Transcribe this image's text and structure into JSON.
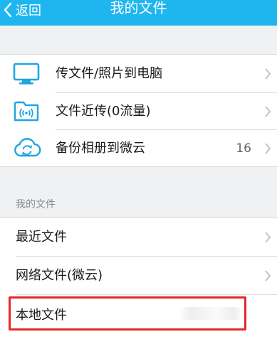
{
  "navbar": {
    "back_label": "返回",
    "title": "我的文件",
    "background_color": "#1fb6f0"
  },
  "top_group": {
    "items": [
      {
        "label": "传文件/照片到电脑",
        "icon": "monitor-icon"
      },
      {
        "label": "文件近传(0流量)",
        "icon": "wireless-folder-icon"
      },
      {
        "label": "备份相册到微云",
        "icon": "cloud-sync-icon",
        "count": "16"
      }
    ]
  },
  "my_files": {
    "section_label": "我的文件",
    "items": [
      {
        "label": "最近文件"
      },
      {
        "label": "网络文件(微云)"
      },
      {
        "label": "本地文件"
      }
    ]
  },
  "colors": {
    "accent": "#1fb6f0",
    "highlight": "#e8262b"
  }
}
